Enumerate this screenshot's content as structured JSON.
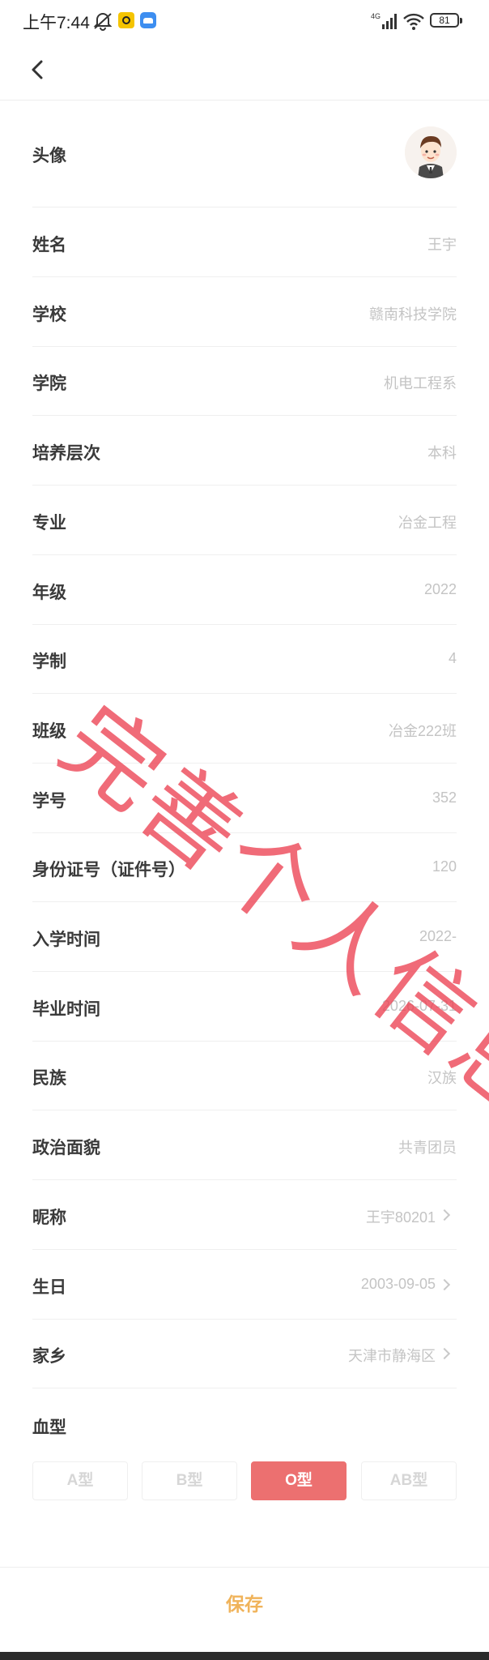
{
  "status_bar": {
    "time": "上午7:44",
    "network": "4G",
    "battery": "81"
  },
  "header": {
    "back_icon": "chevron-left-icon"
  },
  "profile": {
    "avatar_label": "头像",
    "fields": [
      {
        "label": "姓名",
        "value": "王宇"
      },
      {
        "label": "学校",
        "value": "赣南科技学院"
      },
      {
        "label": "学院",
        "value": "机电工程系"
      },
      {
        "label": "培养层次",
        "value": "本科"
      },
      {
        "label": "专业",
        "value": "冶金工程"
      },
      {
        "label": "年级",
        "value": "2022"
      },
      {
        "label": "学制",
        "value": "4"
      },
      {
        "label": "班级",
        "value": "冶金222班"
      },
      {
        "label": "学号",
        "value": "352"
      },
      {
        "label": "身份证号（证件号）",
        "value": "120"
      },
      {
        "label": "入学时间",
        "value": "2022-"
      },
      {
        "label": "毕业时间",
        "value": "2026-07-31"
      },
      {
        "label": "民族",
        "value": "汉族"
      },
      {
        "label": "政治面貌",
        "value": "共青团员"
      },
      {
        "label": "昵称",
        "value": "王宇80201"
      },
      {
        "label": "生日",
        "value": "2003-09-05"
      },
      {
        "label": "家乡",
        "value": "天津市静海区"
      }
    ]
  },
  "blood_type": {
    "label": "血型",
    "options": [
      "A型",
      "B型",
      "O型",
      "AB型"
    ],
    "selected": "O型"
  },
  "footer": {
    "save_label": "保存"
  },
  "watermark": {
    "text": "完善个人信息",
    "color": "#ec4152"
  }
}
